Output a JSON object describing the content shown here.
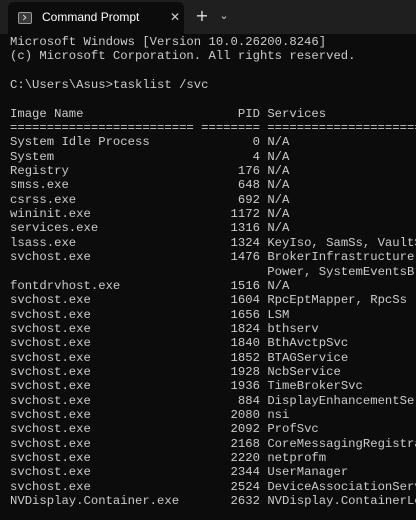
{
  "window": {
    "tab_title": "Command Prompt",
    "close_glyph": "✕",
    "new_tab_glyph": "+",
    "dropdown_glyph": "⌄",
    "tab_icon": "terminal-icon"
  },
  "console": {
    "header": [
      "Microsoft Windows [Version 10.0.26200.8246]",
      "(c) Microsoft Corporation. All rights reserved."
    ],
    "blank": "",
    "command": "C:\\Users\\Asus>tasklist /svc",
    "columns": {
      "image_name": "Image Name",
      "pid": "PID",
      "services": "Services"
    },
    "separator": "========================= ======== ============================================",
    "rows": [
      {
        "image": "System Idle Process",
        "pid": "0",
        "services": "N/A"
      },
      {
        "image": "System",
        "pid": "4",
        "services": "N/A"
      },
      {
        "image": "Registry",
        "pid": "176",
        "services": "N/A"
      },
      {
        "image": "smss.exe",
        "pid": "648",
        "services": "N/A"
      },
      {
        "image": "csrss.exe",
        "pid": "692",
        "services": "N/A"
      },
      {
        "image": "wininit.exe",
        "pid": "1172",
        "services": "N/A"
      },
      {
        "image": "services.exe",
        "pid": "1316",
        "services": "N/A"
      },
      {
        "image": "lsass.exe",
        "pid": "1324",
        "services": "KeyIso, SamSs, VaultSvc"
      },
      {
        "image": "svchost.exe",
        "pid": "1476",
        "services": "BrokerInfrastructure, DcomLaunch,",
        "continuation": "Power, SystemEventsBroker"
      },
      {
        "image": "fontdrvhost.exe",
        "pid": "1516",
        "services": "N/A"
      },
      {
        "image": "svchost.exe",
        "pid": "1604",
        "services": "RpcEptMapper, RpcSs"
      },
      {
        "image": "svchost.exe",
        "pid": "1656",
        "services": "LSM"
      },
      {
        "image": "svchost.exe",
        "pid": "1824",
        "services": "bthserv"
      },
      {
        "image": "svchost.exe",
        "pid": "1840",
        "services": "BthAvctpSvc"
      },
      {
        "image": "svchost.exe",
        "pid": "1852",
        "services": "BTAGService"
      },
      {
        "image": "svchost.exe",
        "pid": "1928",
        "services": "NcbService"
      },
      {
        "image": "svchost.exe",
        "pid": "1936",
        "services": "TimeBrokerSvc"
      },
      {
        "image": "svchost.exe",
        "pid": "884",
        "services": "DisplayEnhancementService"
      },
      {
        "image": "svchost.exe",
        "pid": "2080",
        "services": "nsi"
      },
      {
        "image": "svchost.exe",
        "pid": "2092",
        "services": "ProfSvc"
      },
      {
        "image": "svchost.exe",
        "pid": "2168",
        "services": "CoreMessagingRegistrar"
      },
      {
        "image": "svchost.exe",
        "pid": "2220",
        "services": "netprofm"
      },
      {
        "image": "svchost.exe",
        "pid": "2344",
        "services": "UserManager"
      },
      {
        "image": "svchost.exe",
        "pid": "2524",
        "services": "DeviceAssociationService"
      },
      {
        "image": "NVDisplay.Container.exe",
        "pid": "2632",
        "services": "NVDisplay.ContainerLocalSystem"
      }
    ]
  }
}
